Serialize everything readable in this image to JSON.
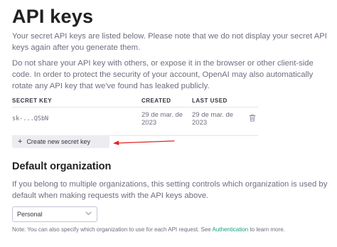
{
  "header": {
    "title": "API keys"
  },
  "intro": {
    "paragraph1": "Your secret API keys are listed below. Please note that we do not display your secret API keys again after you generate them.",
    "paragraph2": "Do not share your API key with others, or expose it in the browser or other client-side code. In order to protect the security of your account, OpenAI may also automatically rotate any API key that we've found has leaked publicly."
  },
  "keys_table": {
    "columns": [
      "SECRET KEY",
      "CREATED",
      "LAST USED"
    ],
    "rows": [
      {
        "secret_key": "sk-...QSbN",
        "created": "29 de mar. de 2023",
        "last_used": "29 de mar. de 2023",
        "action_icon": "trash-icon"
      }
    ]
  },
  "create_button": {
    "icon": "plus-icon",
    "label": "Create new secret key"
  },
  "annotation": {
    "color": "#e02424"
  },
  "default_org": {
    "heading": "Default organization",
    "description": "If you belong to multiple organizations, this setting controls which organization is used by default when making requests with the API keys above.",
    "select_value": "Personal",
    "note_prefix": "Note: You can also specify which organization to use for each API request. See ",
    "note_link": "Authentication",
    "note_suffix": " to learn more."
  },
  "colors": {
    "link": "#10a37f",
    "button_bg": "#ececf1",
    "text_muted": "#6e6e80"
  }
}
